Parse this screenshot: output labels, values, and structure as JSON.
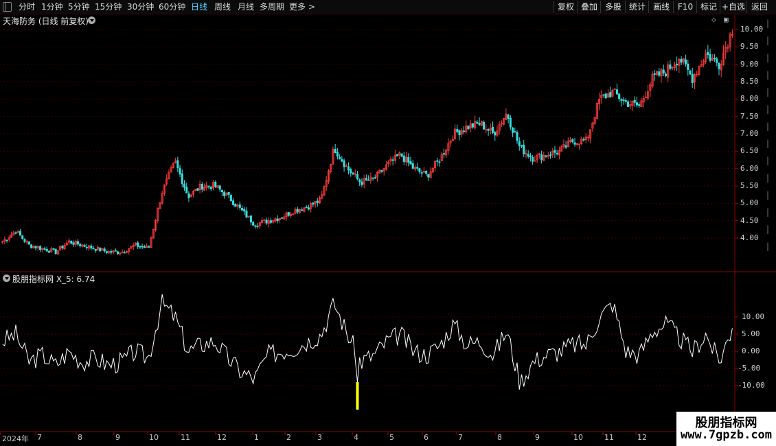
{
  "toolbar": {
    "periods": [
      {
        "label": "分时",
        "active": false
      },
      {
        "label": "1分钟",
        "active": false
      },
      {
        "label": "5分钟",
        "active": false
      },
      {
        "label": "15分钟",
        "active": false
      },
      {
        "label": "30分钟",
        "active": false
      },
      {
        "label": "60分钟",
        "active": false
      },
      {
        "label": "日线",
        "active": true
      },
      {
        "label": "周线",
        "active": false
      },
      {
        "label": "月线",
        "active": false
      },
      {
        "label": "多周期",
        "active": false
      },
      {
        "label": "更多 >",
        "active": false
      }
    ],
    "right_buttons": [
      "复权",
      "叠加",
      "多股",
      "统计",
      "画线",
      "F10",
      "标记",
      "+自选",
      "返回"
    ]
  },
  "price_panel": {
    "title": "天海防务 (日线 前复权)",
    "y_ticks": [
      "10.00",
      "9.50",
      "9.00",
      "8.50",
      "8.00",
      "7.50",
      "7.00",
      "6.50",
      "6.00",
      "5.50",
      "5.00",
      "4.50",
      "4.00"
    ]
  },
  "indicator_panel": {
    "title": "股朋指标网 X_5: 6.74",
    "y_ticks": [
      "10.00",
      "5.00",
      "0.00",
      "-5.00",
      "-10.00"
    ]
  },
  "time_axis": {
    "labels": [
      "2024年",
      "7",
      "8",
      "9",
      "10",
      "11",
      "12",
      "1",
      "2",
      "3",
      "4",
      "5",
      "6",
      "7",
      "8",
      "9",
      "10",
      "11",
      "12"
    ]
  },
  "watermark": {
    "title": "股朋指标网",
    "url": "www.7gpzb.com"
  },
  "colors": {
    "up": "#ff3b3b",
    "down": "#33e0e0",
    "indicator_line": "#ffffff",
    "highlight_bar": "#ffff00",
    "active_tab": "#4fd2ff"
  },
  "chart_data": [
    {
      "type": "candlestick",
      "title": "天海防务 (日线 前复权)",
      "ylim": [
        3.3,
        10.2
      ],
      "x_labels": [
        "2024年",
        "7",
        "8",
        "9",
        "10",
        "11",
        "12",
        "1",
        "2",
        "3",
        "4",
        "5",
        "6",
        "7",
        "8",
        "9",
        "10",
        "11",
        "12"
      ],
      "close_series": [
        3.9,
        4.2,
        3.8,
        3.7,
        3.6,
        3.9,
        3.8,
        3.7,
        3.6,
        3.6,
        3.8,
        3.7,
        5.3,
        6.2,
        5.2,
        5.5,
        5.5,
        5.2,
        4.8,
        4.4,
        4.5,
        4.6,
        4.8,
        4.9,
        5.1,
        6.6,
        6.0,
        5.6,
        5.7,
        6.1,
        6.4,
        6.0,
        5.8,
        6.3,
        7.0,
        7.2,
        7.3,
        7.0,
        7.6,
        6.6,
        6.3,
        6.4,
        6.5,
        6.8,
        6.8,
        8.0,
        8.2,
        7.9,
        7.8,
        8.6,
        8.8,
        9.2,
        8.6,
        9.3,
        9.0,
        10.0
      ],
      "ylabel": ""
    },
    {
      "type": "line",
      "title": "股朋指标网 X_5: 6.74",
      "ylim": [
        -14,
        17
      ],
      "y_ticks": [
        10,
        5,
        0,
        -5,
        -10
      ],
      "series": [
        {
          "name": "X_5",
          "values": [
            3,
            5,
            -3,
            -1,
            -4,
            0,
            -3,
            -2,
            -4,
            -3,
            0,
            -2,
            14,
            10,
            0,
            2,
            3,
            -2,
            -6,
            -8,
            -1,
            0,
            1,
            3,
            5,
            14,
            5,
            -3,
            -1,
            3,
            5,
            0,
            -1,
            2,
            8,
            2,
            3,
            -1,
            6,
            -9,
            -3,
            -1,
            0,
            2,
            2,
            10,
            14,
            0,
            -1,
            6,
            8,
            4,
            0,
            5,
            -3,
            6.74
          ]
        }
      ],
      "highlight_min": -17
    }
  ]
}
